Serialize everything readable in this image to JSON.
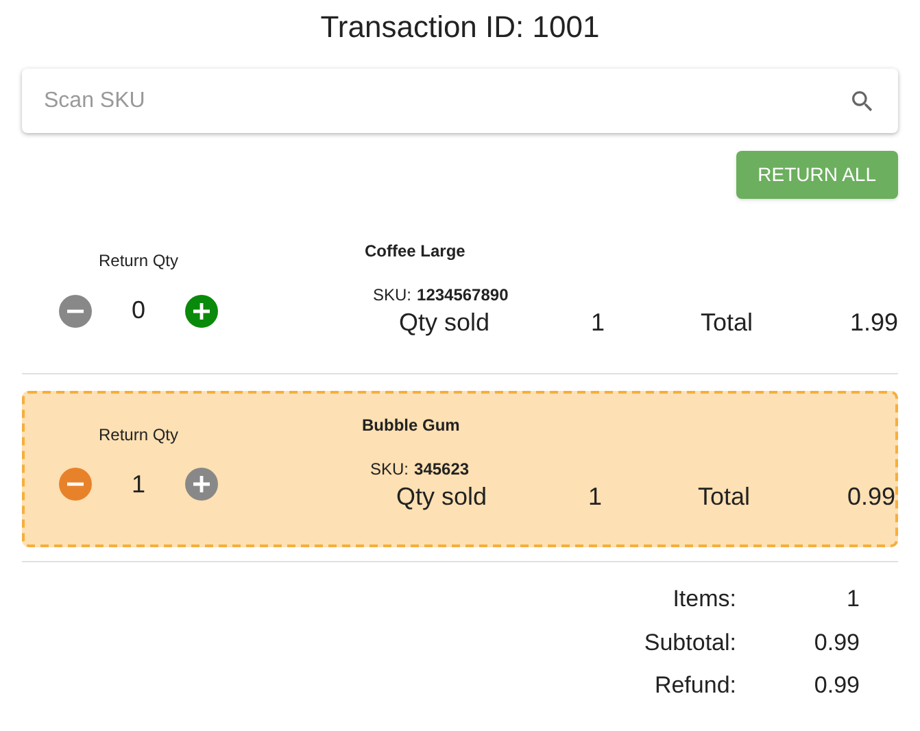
{
  "title": "Transaction ID: 1001",
  "search": {
    "placeholder": "Scan SKU"
  },
  "return_all_button": "RETURN ALL",
  "items": [
    {
      "return_qty_label": "Return Qty",
      "qty": "0",
      "decrease_disabled": true,
      "increase_disabled": false,
      "name": "Coffee Large",
      "sku_label": "SKU:",
      "sku": "1234567890",
      "qty_sold_label": "Qty sold",
      "qty_sold": "1",
      "total_label": "Total",
      "total": "1.99",
      "selected": false
    },
    {
      "return_qty_label": "Return Qty",
      "qty": "1",
      "decrease_disabled": false,
      "increase_disabled": true,
      "name": "Bubble Gum",
      "sku_label": "SKU:",
      "sku": "345623",
      "qty_sold_label": "Qty sold",
      "qty_sold": "1",
      "total_label": "Total",
      "total": "0.99",
      "selected": true
    }
  ],
  "summary": [
    {
      "label": "Items:",
      "value": "1"
    },
    {
      "label": "Subtotal:",
      "value": "0.99"
    },
    {
      "label": "Refund:",
      "value": "0.99"
    }
  ]
}
